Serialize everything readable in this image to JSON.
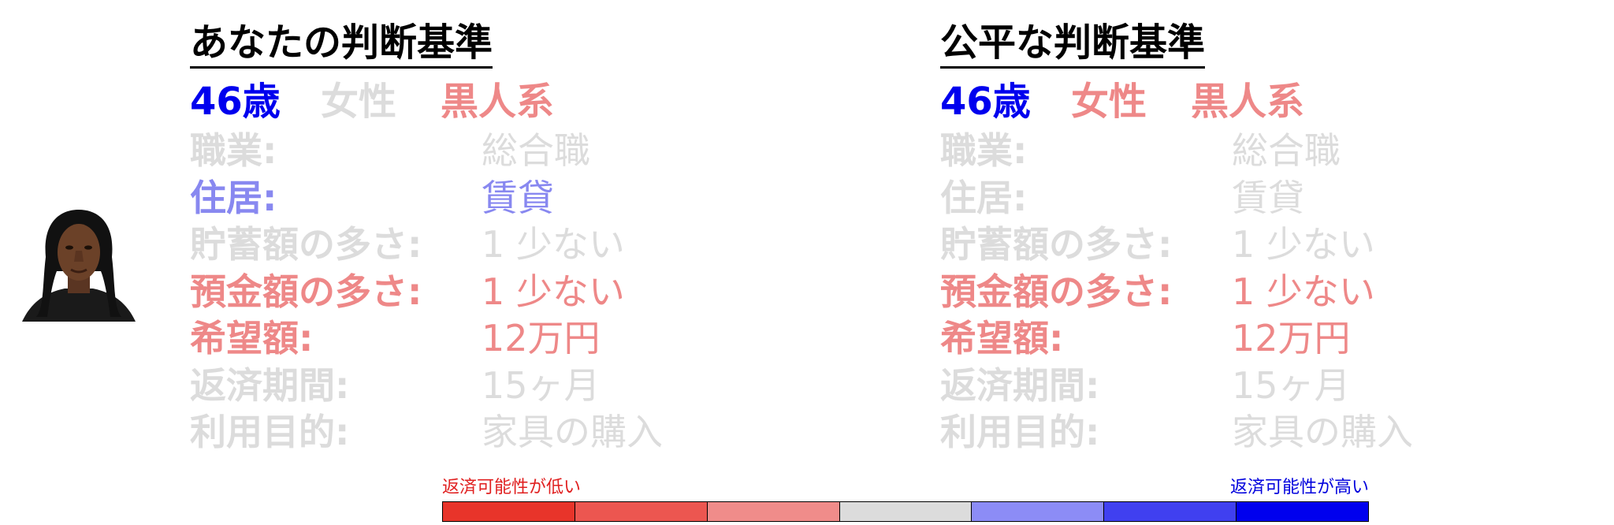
{
  "colors": {
    "muted": "#dcdcdc",
    "blue_strong": "#0000ee",
    "blue_light": "#8888f0",
    "red_light": "#ee8888",
    "red_label": "#e02020",
    "blue_label": "#0000dd"
  },
  "left": {
    "title": "あなたの判断基準",
    "age": "46歳",
    "gender": "女性",
    "ethnicity": "黒人系",
    "rows": [
      {
        "label": "職業:",
        "value": "総合職"
      },
      {
        "label": "住居:",
        "value": "賃貸"
      },
      {
        "label": "貯蓄額の多さ:",
        "value": "1 少ない"
      },
      {
        "label": "預金額の多さ:",
        "value": "1 少ない"
      },
      {
        "label": "希望額:",
        "value": "12万円"
      },
      {
        "label": "返済期間:",
        "value": "15ヶ月"
      },
      {
        "label": "利用目的:",
        "value": "家具の購入"
      }
    ]
  },
  "right": {
    "title": "公平な判断基準",
    "age": "46歳",
    "gender": "女性",
    "ethnicity": "黒人系",
    "rows": [
      {
        "label": "職業:",
        "value": "総合職"
      },
      {
        "label": "住居:",
        "value": "賃貸"
      },
      {
        "label": "貯蓄額の多さ:",
        "value": "1 少ない"
      },
      {
        "label": "預金額の多さ:",
        "value": "1 少ない"
      },
      {
        "label": "希望額:",
        "value": "12万円"
      },
      {
        "label": "返済期間:",
        "value": "15ヶ月"
      },
      {
        "label": "利用目的:",
        "value": "家具の購入"
      }
    ]
  },
  "scale": {
    "low_label": "返済可能性が低い",
    "high_label": "返済可能性が高い",
    "segments": [
      "#e8342a",
      "#ec5650",
      "#f08c8a",
      "#dcdcdc",
      "#8c8cf6",
      "#4040f0",
      "#0000ee"
    ]
  }
}
